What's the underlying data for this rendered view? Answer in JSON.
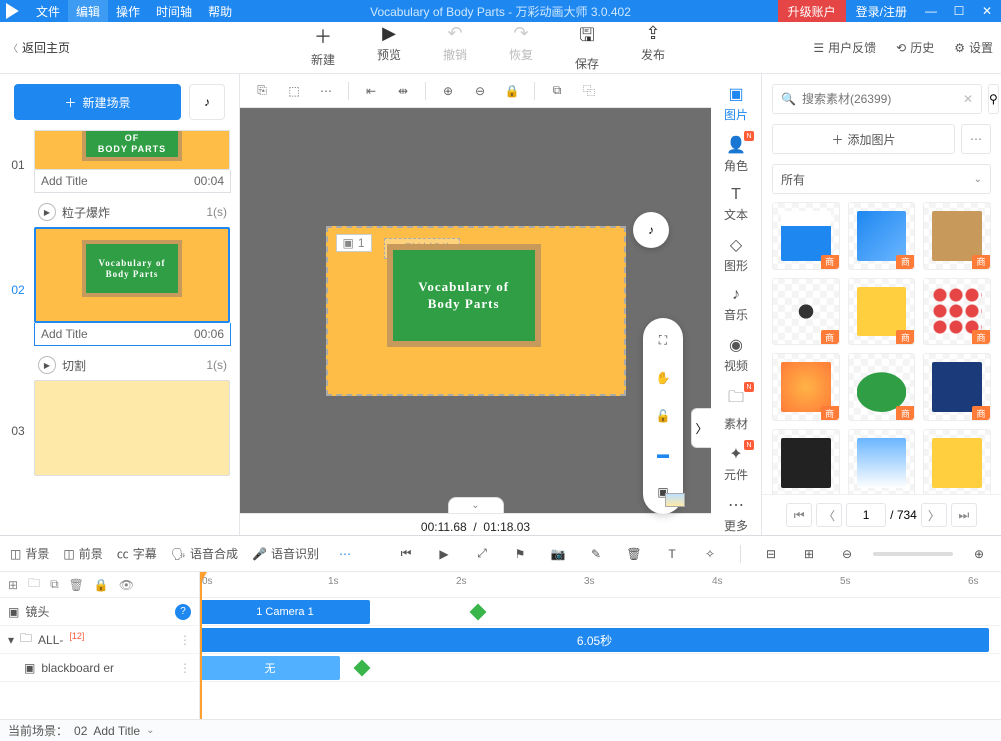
{
  "titlebar": {
    "menus": [
      "文件",
      "编辑",
      "操作",
      "时间轴",
      "帮助"
    ],
    "title": "Vocabulary of Body Parts - 万彩动画大师 3.0.402",
    "upgrade": "升级账户",
    "login": "登录/注册"
  },
  "topbar": {
    "back": "返回主页",
    "actions": [
      {
        "l": "新建"
      },
      {
        "l": "预览"
      },
      {
        "l": "撤销",
        "d": true
      },
      {
        "l": "恢复",
        "d": true
      },
      {
        "l": "保存"
      },
      {
        "l": "发布"
      }
    ],
    "right": [
      {
        "l": "用户反馈"
      },
      {
        "l": "历史"
      },
      {
        "l": "设置"
      }
    ]
  },
  "left": {
    "newScene": "新建场景",
    "scene01": {
      "num": "01",
      "board": "VOCABULARY OF\nBODY PARTS",
      "title": "Add Title",
      "time": "00:04",
      "trans": "粒子爆炸",
      "dur": "1(s)"
    },
    "scene02": {
      "num": "02",
      "board": "Vocabulary of\nBody Parts",
      "title": "Add Title",
      "time": "00:06",
      "trans": "切割",
      "dur": "1(s)"
    },
    "scene03": {
      "num": "03"
    }
  },
  "canvas": {
    "camLabel": "1",
    "lens": "默认镜头",
    "board": "Vocabulary of\nBody Parts",
    "time": "00:11.68",
    "total": "01:18.03"
  },
  "rail": [
    {
      "l": "图片",
      "a": true
    },
    {
      "l": "角色",
      "n": true
    },
    {
      "l": "文本"
    },
    {
      "l": "图形"
    },
    {
      "l": "音乐"
    },
    {
      "l": "视频"
    },
    {
      "l": "素材",
      "n": true
    },
    {
      "l": "元件",
      "n": true
    },
    {
      "l": "更多"
    }
  ],
  "right": {
    "placeholder": "搜索素材(26399)",
    "add": "添加图片",
    "filter": "所有",
    "page": "1",
    "total": "734",
    "label": "商"
  },
  "timeline": {
    "tabs": [
      "背景",
      "前景",
      "字幕",
      "语音合成",
      "语音识别"
    ],
    "lens": "镜头",
    "all": "ALL-",
    "allSup": "[12]",
    "layer": "blackboard er",
    "camera": "1 Camera 1",
    "duration": "6.05秒",
    "enter": "无",
    "ticks": [
      "0s",
      "1s",
      "2s",
      "3s",
      "4s",
      "5s",
      "6s"
    ]
  },
  "status": {
    "scene": "当前场景：",
    "num": "02",
    "title": "Add Title"
  }
}
